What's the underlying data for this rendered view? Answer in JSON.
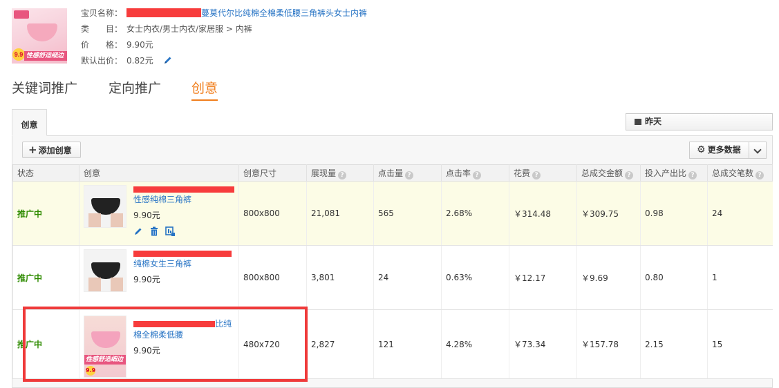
{
  "product": {
    "name_label": "宝贝名称：",
    "name_value": "蔓莫代尔比纯棉全棉柔低腰三角裤头女士内裤",
    "category_label": "类　　目：",
    "category_value": "女士内衣/男士内衣/家居服 > 内裤",
    "price_label": "价　　格：",
    "price_value": "9.90元",
    "default_bid_label": "默认出价：",
    "default_bid_value": "0.82元",
    "thumb_badge": "9.9",
    "thumb_strip": "性感舒适细边"
  },
  "main_tabs": [
    {
      "label": "关键词推广"
    },
    {
      "label": "定向推广"
    },
    {
      "label": "创意"
    }
  ],
  "sub_tab": {
    "label": "创意"
  },
  "toolbar": {
    "date_label": "昨天",
    "add_label": "添加创意",
    "more_label": "更多数据"
  },
  "table": {
    "headers": [
      "状态",
      "创意",
      "创意尺寸",
      "展现量",
      "点击量",
      "点击率",
      "花费",
      "总成交金额",
      "投入产出比",
      "总成交笔数"
    ],
    "rows": [
      {
        "status": "推广中",
        "title": "性感纯棉三角裤",
        "price": "9.90元",
        "size": "800x800",
        "impressions": "21,081",
        "clicks": "565",
        "ctr": "2.68%",
        "cost": "￥314.48",
        "gmv": "￥309.75",
        "roi": "0.98",
        "orders": "24"
      },
      {
        "status": "推广中",
        "title": "纯棉女生三角裤",
        "price": "9.90元",
        "size": "800x800",
        "impressions": "3,801",
        "clicks": "24",
        "ctr": "0.63%",
        "cost": "￥12.17",
        "gmv": "￥9.69",
        "roi": "0.80",
        "orders": "1"
      },
      {
        "status": "推广中",
        "title_a": "比纯",
        "title_b": "棉全棉柔低腰",
        "price": "9.90元",
        "size": "480x720",
        "impressions": "2,827",
        "clicks": "121",
        "ctr": "4.28%",
        "cost": "￥73.34",
        "gmv": "￥157.78",
        "roi": "2.15",
        "orders": "15",
        "thumb_strip": "性感舒适细边",
        "thumb_badge": "9.9"
      }
    ]
  },
  "colors": {
    "accent": "#f07e1c",
    "link": "#2673c4",
    "status_green": "#2e8b00",
    "highlight_red": "#ef3a3a"
  }
}
